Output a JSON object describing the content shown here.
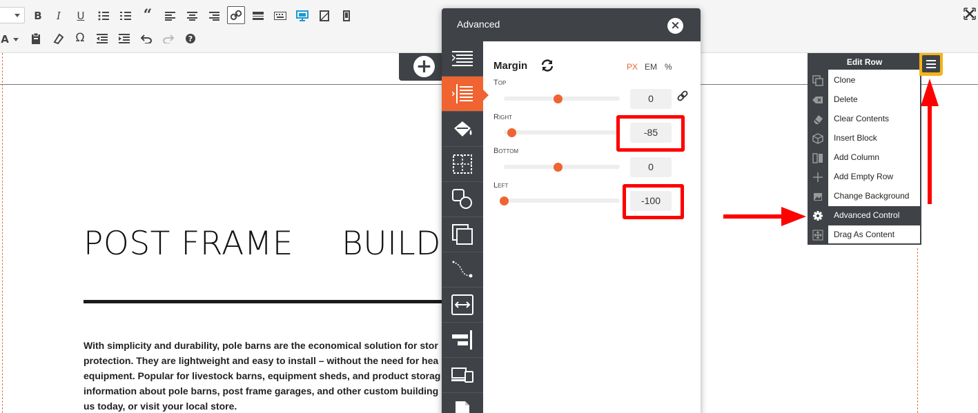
{
  "canvas": {
    "heading_left": "POST FRAME",
    "heading_right": "BUILD",
    "paragraph_lines": [
      "With simplicity and durability, pole barns are the economical solution for stor",
      "protection. They are lightweight and easy to install – without the need for hea",
      "equipment. Popular for livestock barns, equipment sheds, and product storag",
      "information about pole barns, post frame garages, and other custom building",
      "us today, or visit your local store."
    ]
  },
  "advanced_panel": {
    "title": "Advanced",
    "margin_label": "Margin",
    "units": [
      "PX",
      "EM",
      "%"
    ],
    "active_unit": "PX",
    "fields": [
      {
        "label": "Top",
        "value": "0",
        "level": 0.5
      },
      {
        "label": "Right",
        "value": "-85",
        "level": 0.07
      },
      {
        "label": "Bottom",
        "value": "0",
        "level": 0.5
      },
      {
        "label": "Left",
        "value": "-100",
        "level": 0
      }
    ]
  },
  "edit_row_menu": {
    "title": "Edit Row",
    "items": [
      {
        "label": "Clone",
        "icon": "clone-icon"
      },
      {
        "label": "Delete",
        "icon": "delete-icon"
      },
      {
        "label": "Clear Contents",
        "icon": "eraser-icon"
      },
      {
        "label": "Insert Block",
        "icon": "cube-icon"
      },
      {
        "label": "Add Column",
        "icon": "column-icon"
      },
      {
        "label": "Add Empty Row",
        "icon": "plus-icon"
      },
      {
        "label": "Change Background",
        "icon": "image-icon"
      },
      {
        "label": "Advanced Control",
        "icon": "gear-icon"
      },
      {
        "label": "Drag As Content",
        "icon": "drag-icon"
      }
    ],
    "selected": "Advanced Control"
  },
  "colors": {
    "accent": "#ef6431",
    "panel_dark": "#3f4347",
    "highlight": "#ff0000",
    "menu_toggle": "#f4b41a"
  }
}
